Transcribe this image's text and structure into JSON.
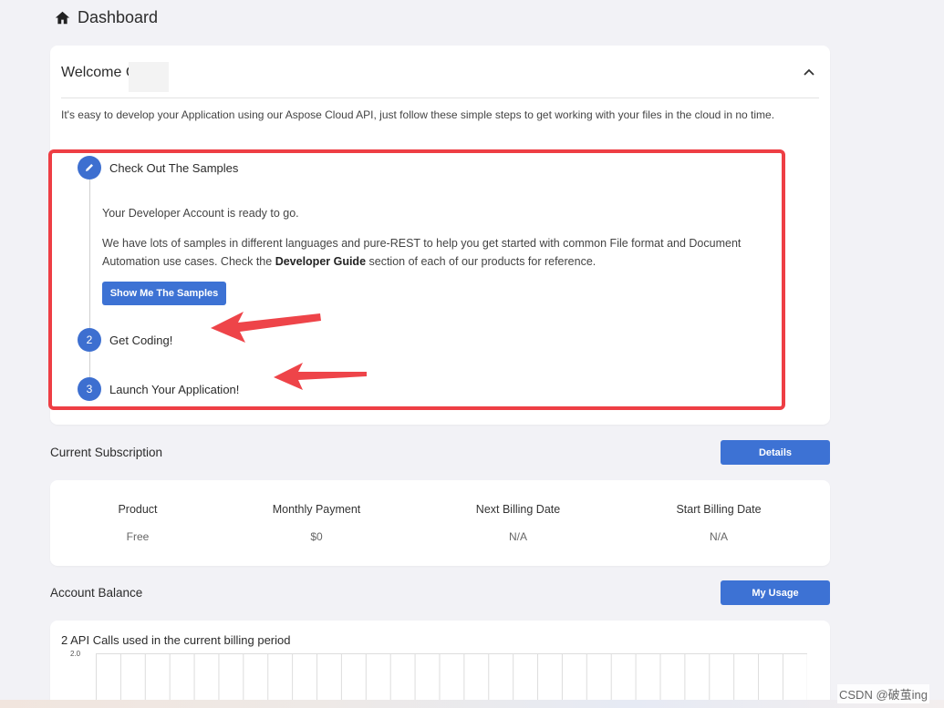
{
  "page": {
    "title": "Dashboard"
  },
  "welcome": {
    "heading": "Welcome C",
    "intro": "It's easy to develop your Application using our Aspose Cloud API, just follow these simple steps to get working with your files in the cloud in no time.",
    "steps": [
      {
        "marker_icon": "pencil-icon",
        "label": "Check Out The Samples",
        "line1": "Your Developer Account is ready to go.",
        "line2a": "We have lots of samples in different languages and pure-REST to help you get started with common File format and Document Automation use cases. Check the ",
        "line2b": "Developer Guide",
        "line2c": " section of each of our products for reference.",
        "button": "Show Me The Samples"
      },
      {
        "marker": "2",
        "label": "Get Coding!"
      },
      {
        "marker": "3",
        "label": "Launch Your Application!"
      }
    ]
  },
  "subscription": {
    "title": "Current Subscription",
    "button": "Details",
    "columns": [
      {
        "header": "Product",
        "value": "Free"
      },
      {
        "header": "Monthly Payment",
        "value": "$0"
      },
      {
        "header": "Next Billing Date",
        "value": "N/A"
      },
      {
        "header": "Start Billing Date",
        "value": "N/A"
      }
    ]
  },
  "balance": {
    "title": "Account Balance",
    "button": "My Usage",
    "chart_title": "2 API Calls used in the current billing period",
    "y_tick": "2.0"
  },
  "watermark": "CSDN @破茧ing",
  "colors": {
    "accent": "#3d72d4",
    "highlight": "#ee3e44",
    "background": "#f2f2f6"
  }
}
